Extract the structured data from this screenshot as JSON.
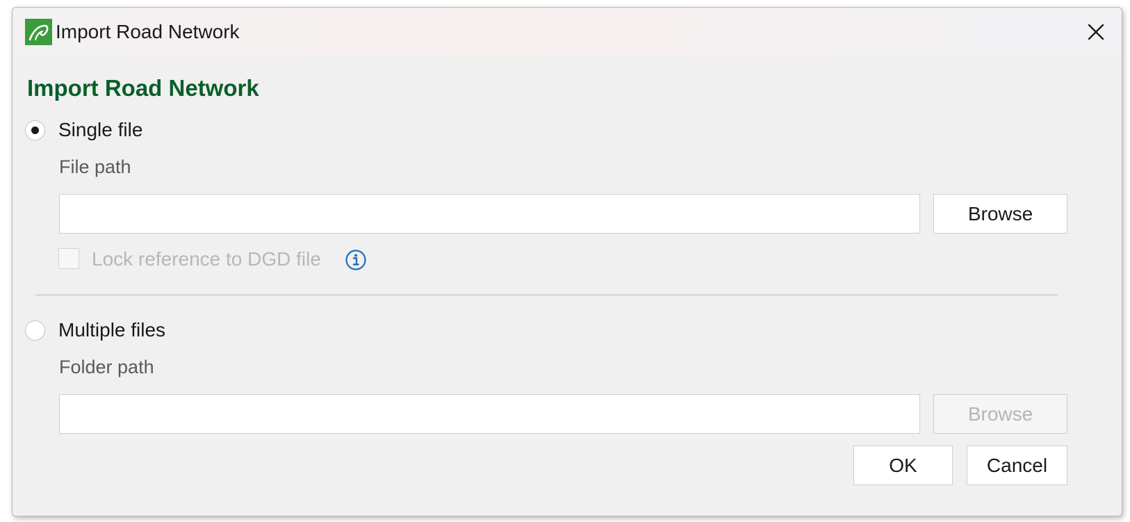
{
  "window": {
    "title": "Import Road Network",
    "app_icon": "road-leaf-icon",
    "close_icon": "close-icon"
  },
  "dialog": {
    "heading": "Import Road Network",
    "single_file": {
      "label": "Single file",
      "selected": true,
      "field_label": "File path",
      "path_value": "",
      "browse_label": "Browse",
      "lock_label": "Lock reference to DGD file",
      "lock_checked": false,
      "info_icon": "info-icon"
    },
    "multiple_files": {
      "label": "Multiple files",
      "selected": false,
      "field_label": "Folder path",
      "path_value": "",
      "browse_label": "Browse"
    },
    "buttons": {
      "ok": "OK",
      "cancel": "Cancel"
    }
  },
  "colors": {
    "heading": "#0b5e2a",
    "app_icon_bg": "#3c9b3c",
    "info_icon": "#1f6fb8",
    "disabled_text": "#b7b7b7"
  }
}
